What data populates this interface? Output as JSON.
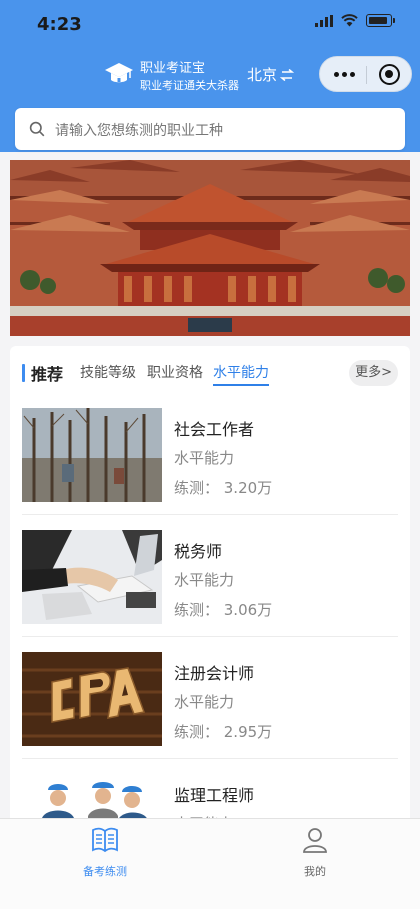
{
  "status_bar": {
    "time": "4:23"
  },
  "header": {
    "app_name": "职业考证宝",
    "app_subtitle": "职业考证通关大杀器",
    "city": "北京",
    "capsule": {
      "more_icon": "more-dots-icon",
      "close_icon": "target-icon"
    }
  },
  "search": {
    "placeholder": "请输入您想练测的职业工种"
  },
  "banner": {
    "subject": "Forbidden City palace rooftops"
  },
  "tabs": {
    "recommend_label": "推荐",
    "items": [
      {
        "label": "技能等级"
      },
      {
        "label": "职业资格"
      },
      {
        "label": "水平能力"
      }
    ],
    "active_index": 2,
    "more_label": "更多>"
  },
  "list": [
    {
      "title": "社会工作者",
      "category": "水平能力",
      "count_text": "练测： 3.20万"
    },
    {
      "title": "税务师",
      "category": "水平能力",
      "count_text": "练测： 3.06万"
    },
    {
      "title": "注册会计师",
      "category": "水平能力",
      "count_text": "练测： 2.95万"
    },
    {
      "title": "监理工程师",
      "category": "水平能力",
      "count_text": ""
    }
  ],
  "tabbar": {
    "items": [
      {
        "label": "备考练测",
        "icon": "book-icon",
        "active": true
      },
      {
        "label": "我的",
        "icon": "user-icon",
        "active": false
      }
    ]
  },
  "colors": {
    "primary": "#4a94ec",
    "accent": "#2f80e8",
    "text": "#222222",
    "muted": "#888888"
  }
}
